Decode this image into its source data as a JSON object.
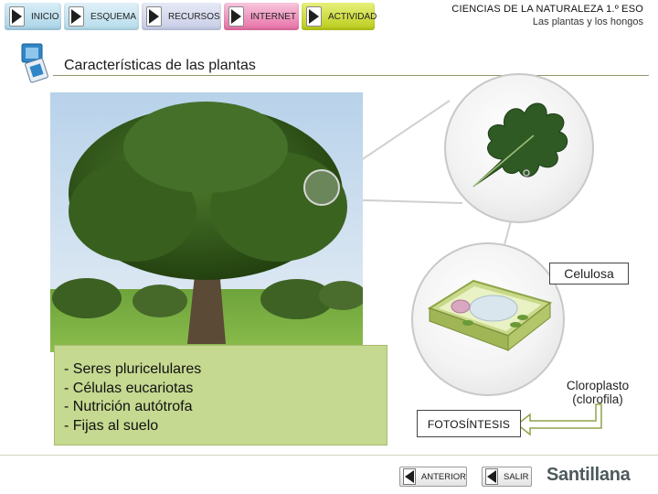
{
  "nav": {
    "items": [
      {
        "label": "INICIO",
        "icon": "play-icon"
      },
      {
        "label": "ESQUEMA",
        "icon": "play-icon"
      },
      {
        "label": "RECURSOS",
        "icon": "play-icon"
      },
      {
        "label": "INTERNET",
        "icon": "play-icon"
      },
      {
        "label": "ACTIVIDAD",
        "icon": "play-icon"
      }
    ]
  },
  "header": {
    "title": "CIENCIAS DE LA NATURALEZA 1.º ESO",
    "subtitle": "Las plantas y los hongos"
  },
  "section": {
    "title": "Características de las plantas"
  },
  "info": {
    "items": [
      "Seres pluricelulares",
      "Células eucariotas",
      "Nutrición autótrofa",
      "Fijas al suelo"
    ]
  },
  "labels": {
    "celulosa": "Celulosa",
    "cloroplasto_line1": "Cloroplasto",
    "cloroplasto_line2": "(clorofila)",
    "fotosintesis": "FOTOSÍNTESIS"
  },
  "footer": {
    "anterior": "ANTERIOR",
    "salir": "SALIR",
    "brand": "Santillana"
  },
  "colors": {
    "info_box": "#c5d990",
    "nav_internet": "#e86fa5",
    "nav_actividad": "#b9cc18",
    "rule": "#8a9a6a"
  }
}
